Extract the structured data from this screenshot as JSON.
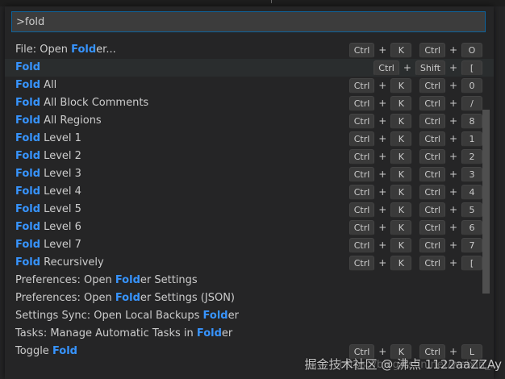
{
  "search": {
    "value": ">fold"
  },
  "commands": [
    {
      "segments": [
        {
          "t": "File: Open ",
          "h": false
        },
        {
          "t": "Fold",
          "h": true
        },
        {
          "t": "er...",
          "h": false
        }
      ],
      "keys": [
        [
          "Ctrl",
          "K"
        ],
        [
          "Ctrl",
          "O"
        ]
      ],
      "focused": false
    },
    {
      "segments": [
        {
          "t": "Fold",
          "h": true
        }
      ],
      "keys": [
        [
          "Ctrl",
          "Shift",
          "["
        ]
      ],
      "focused": true
    },
    {
      "segments": [
        {
          "t": "Fold",
          "h": true
        },
        {
          "t": " All",
          "h": false
        }
      ],
      "keys": [
        [
          "Ctrl",
          "K"
        ],
        [
          "Ctrl",
          "0"
        ]
      ],
      "focused": false
    },
    {
      "segments": [
        {
          "t": "Fold",
          "h": true
        },
        {
          "t": " All Block Comments",
          "h": false
        }
      ],
      "keys": [
        [
          "Ctrl",
          "K"
        ],
        [
          "Ctrl",
          "/"
        ]
      ],
      "focused": false
    },
    {
      "segments": [
        {
          "t": "Fold",
          "h": true
        },
        {
          "t": " All Regions",
          "h": false
        }
      ],
      "keys": [
        [
          "Ctrl",
          "K"
        ],
        [
          "Ctrl",
          "8"
        ]
      ],
      "focused": false
    },
    {
      "segments": [
        {
          "t": "Fold",
          "h": true
        },
        {
          "t": " Level 1",
          "h": false
        }
      ],
      "keys": [
        [
          "Ctrl",
          "K"
        ],
        [
          "Ctrl",
          "1"
        ]
      ],
      "focused": false
    },
    {
      "segments": [
        {
          "t": "Fold",
          "h": true
        },
        {
          "t": " Level 2",
          "h": false
        }
      ],
      "keys": [
        [
          "Ctrl",
          "K"
        ],
        [
          "Ctrl",
          "2"
        ]
      ],
      "focused": false
    },
    {
      "segments": [
        {
          "t": "Fold",
          "h": true
        },
        {
          "t": " Level 3",
          "h": false
        }
      ],
      "keys": [
        [
          "Ctrl",
          "K"
        ],
        [
          "Ctrl",
          "3"
        ]
      ],
      "focused": false
    },
    {
      "segments": [
        {
          "t": "Fold",
          "h": true
        },
        {
          "t": " Level 4",
          "h": false
        }
      ],
      "keys": [
        [
          "Ctrl",
          "K"
        ],
        [
          "Ctrl",
          "4"
        ]
      ],
      "focused": false
    },
    {
      "segments": [
        {
          "t": "Fold",
          "h": true
        },
        {
          "t": " Level 5",
          "h": false
        }
      ],
      "keys": [
        [
          "Ctrl",
          "K"
        ],
        [
          "Ctrl",
          "5"
        ]
      ],
      "focused": false
    },
    {
      "segments": [
        {
          "t": "Fold",
          "h": true
        },
        {
          "t": " Level 6",
          "h": false
        }
      ],
      "keys": [
        [
          "Ctrl",
          "K"
        ],
        [
          "Ctrl",
          "6"
        ]
      ],
      "focused": false
    },
    {
      "segments": [
        {
          "t": "Fold",
          "h": true
        },
        {
          "t": " Level 7",
          "h": false
        }
      ],
      "keys": [
        [
          "Ctrl",
          "K"
        ],
        [
          "Ctrl",
          "7"
        ]
      ],
      "focused": false
    },
    {
      "segments": [
        {
          "t": "Fold",
          "h": true
        },
        {
          "t": " Recursively",
          "h": false
        }
      ],
      "keys": [
        [
          "Ctrl",
          "K"
        ],
        [
          "Ctrl",
          "["
        ]
      ],
      "focused": false
    },
    {
      "segments": [
        {
          "t": "Preferences: Open ",
          "h": false
        },
        {
          "t": "Fold",
          "h": true
        },
        {
          "t": "er Settings",
          "h": false
        }
      ],
      "keys": [],
      "focused": false
    },
    {
      "segments": [
        {
          "t": "Preferences: Open ",
          "h": false
        },
        {
          "t": "Fold",
          "h": true
        },
        {
          "t": "er Settings (JSON)",
          "h": false
        }
      ],
      "keys": [],
      "focused": false
    },
    {
      "segments": [
        {
          "t": "Settings Sync: Open Local Backups ",
          "h": false
        },
        {
          "t": "Fold",
          "h": true
        },
        {
          "t": "er",
          "h": false
        }
      ],
      "keys": [],
      "focused": false
    },
    {
      "segments": [
        {
          "t": "Tasks: Manage Automatic Tasks in ",
          "h": false
        },
        {
          "t": "Fold",
          "h": true
        },
        {
          "t": "er",
          "h": false
        }
      ],
      "keys": [],
      "focused": false
    },
    {
      "segments": [
        {
          "t": "Toggle ",
          "h": false
        },
        {
          "t": "Fold",
          "h": true
        }
      ],
      "keys": [
        [
          "Ctrl",
          "K"
        ],
        [
          "Ctrl",
          "L"
        ]
      ],
      "focused": false
    }
  ],
  "watermark": "掘金技术社区 @ 沸点 1122aaZZAy",
  "watermark_bg": "https://blog.csdn.net/weixin_..."
}
